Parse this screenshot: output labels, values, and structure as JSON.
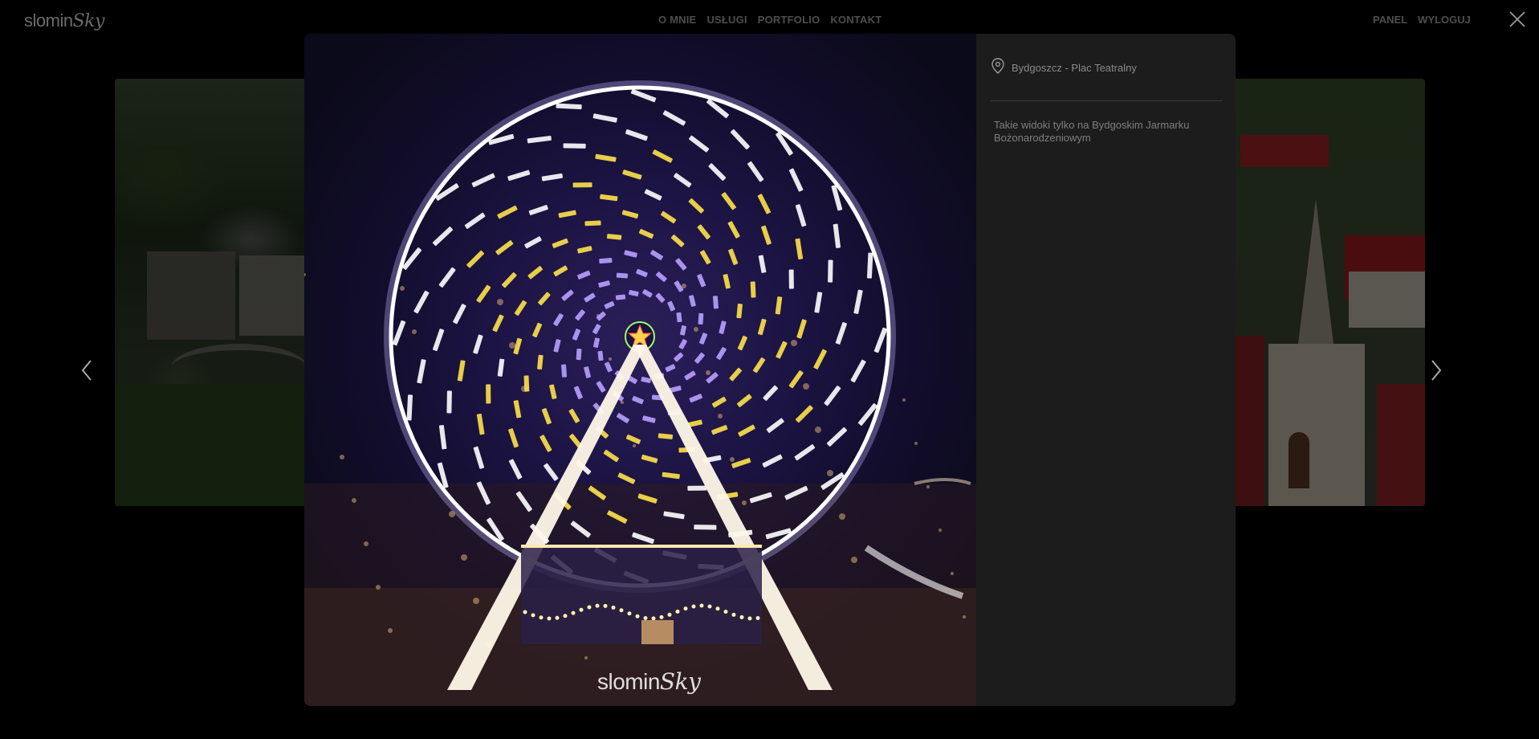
{
  "header": {
    "logo_main": "slomin",
    "logo_accent": "Sky",
    "nav": [
      {
        "label": "O MNIE"
      },
      {
        "label": "USŁUGI"
      },
      {
        "label": "PORTFOLIO"
      },
      {
        "label": "KONTAKT"
      }
    ],
    "nav_right": [
      {
        "label": "PANEL"
      },
      {
        "label": "WYLOGUJ"
      }
    ],
    "close_icon": "close-icon"
  },
  "carousel": {
    "prev_icon": "chevron-left-icon",
    "next_icon": "chevron-right-icon"
  },
  "lightbox": {
    "watermark_main": "slomin",
    "watermark_accent": "Sky",
    "location_icon": "map-pin-icon",
    "location": "Bydgoszcz - Plac Teatralny",
    "description": "Takie widoki tylko na Bydgoskim Jarmarku Bożonarodzeniowym"
  },
  "colors": {
    "background": "#000000",
    "panel": "#1c1c1c",
    "nav_text": "#4d4d4d",
    "info_text": "#8a8a8a"
  }
}
